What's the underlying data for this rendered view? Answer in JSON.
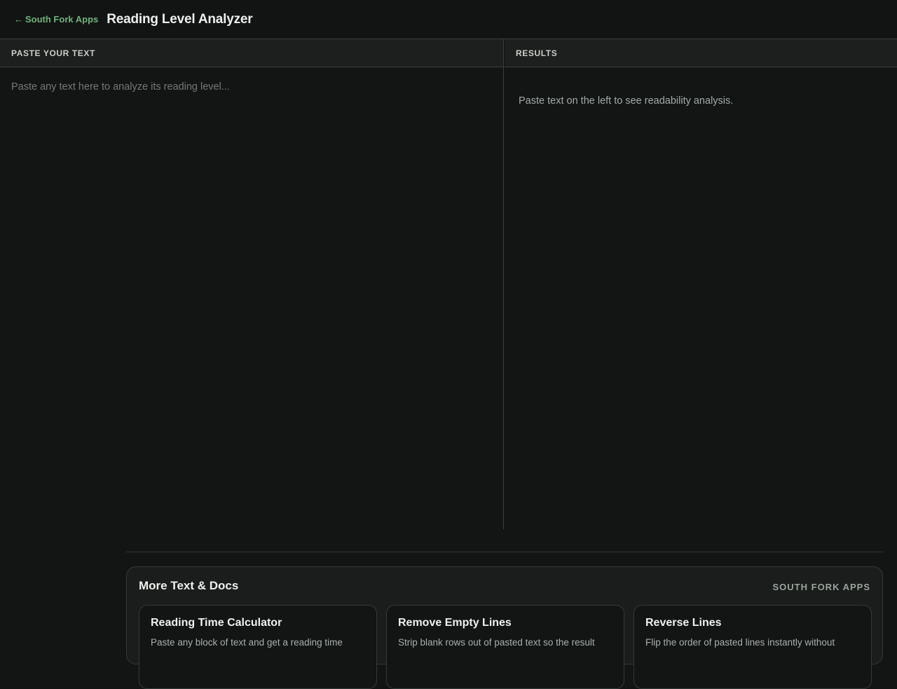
{
  "header": {
    "back_arrow": "←",
    "back_label": "South Fork Apps",
    "title": "Reading Level Analyzer"
  },
  "input_pane": {
    "header": "PASTE YOUR TEXT",
    "value": "",
    "placeholder": "Paste any text here to analyze its reading level..."
  },
  "results_pane": {
    "header": "RESULTS",
    "empty_message": "Paste text on the left to see readability analysis."
  },
  "more": {
    "title": "More Text & Docs",
    "brand": "SOUTH FORK APPS",
    "tools": [
      {
        "name": "Reading Time Calculator",
        "description": "Paste any block of text and get a reading time"
      },
      {
        "name": "Remove Empty Lines",
        "description": "Strip blank rows out of pasted text so the result"
      },
      {
        "name": "Reverse Lines",
        "description": "Flip the order of pasted lines instantly without"
      }
    ]
  },
  "colors": {
    "background": "#131514",
    "accent_link": "#6fb27c",
    "panel_header": "#1c1f1d",
    "border": "#3a3f3c"
  }
}
